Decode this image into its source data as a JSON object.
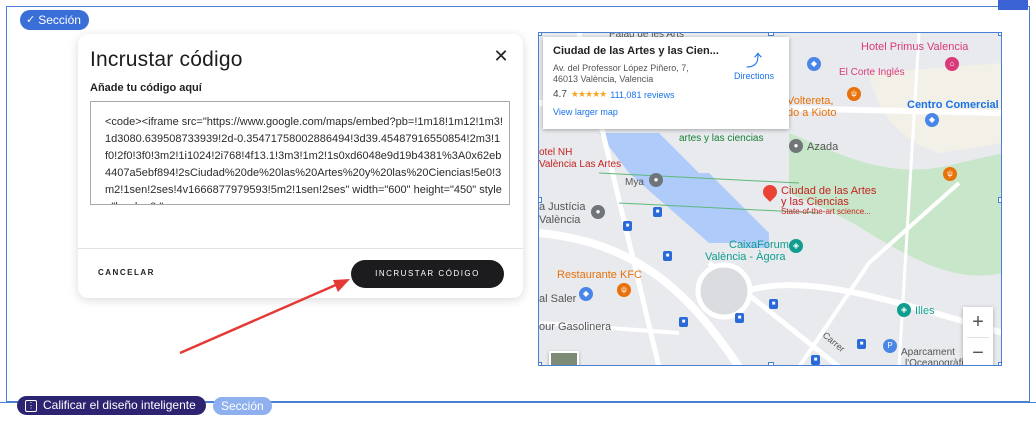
{
  "section_badge": {
    "icon": "check-icon",
    "label": "Sección"
  },
  "modal": {
    "title": "Incrustar código",
    "close_icon": "close-icon",
    "label": "Añade tu código aquí",
    "code": "<code><iframe src=\"https://www.google.com/maps/embed?pb=!1m18!1m12!1m3!1d3080.639508733939!2d-0.35471758002886494!3d39.45487916550854!2m3!1f0!2f0!3f0!3m2!1i1024!2i768!4f13.1!3m3!1m2!1s0xd6048e9d19b4381%3A0x62eb4407a5ebf894!2sCiudad%20de%20las%20Artes%20y%20las%20Ciencias!5e0!3m2!1sen!2ses!4v1666877979593!5m2!1sen!2ses\" width=\"600\" height=\"450\" style=\"border:0;\"",
    "cancel_label": "CANCELAR",
    "submit_label": "INCRUSTAR CÓDIGO"
  },
  "map": {
    "place_name": "Ciudad de las Artes y las Cien...",
    "address_line1": "Av. del Professor López Piñero, 7,",
    "address_line2": "46013 València, Valencia",
    "rating": "4.7",
    "stars": "★★★★★",
    "reviews": "111,081 reviews",
    "larger_map": "View larger map",
    "directions": "Directions",
    "labels": {
      "palau": "Palau de les Arts",
      "hotel_primus": "Hotel Primus Valencia",
      "el_corte": "El Corte Inglés",
      "centro_comercial": "Centro Comercial",
      "voltereta": "Voltereta,",
      "do_a_kioto": "do a Kioto",
      "artes_ciencias": "artes y las ciencias",
      "azada": "Azada",
      "tel_nh": "otel NH",
      "valencia_artes": "València Las Artes",
      "mya": "Mya",
      "ciudad_line1": "Ciudad de las Artes",
      "ciudad_line2": "y las Ciencias",
      "ciudad_sub": "State-of-the-art science...",
      "justicia": "a Justícia",
      "valencia_j": "València",
      "caixaforum": "CaixaForum",
      "caixaforum2": "València - Àgora",
      "kfc": "Restaurante KFC",
      "saler": "al Saler",
      "gasolinera": "our Gasolinera",
      "illes": "Illes",
      "aparcament": "Aparcament",
      "oceanografic": "l'Oceanogràfic",
      "carrer": "Carrer"
    },
    "zoom_in": "+",
    "zoom_out": "−"
  },
  "bottom": {
    "rate_label": "Calificar el diseño inteligente",
    "rate_icon": "rate-layout-icon",
    "section_label": "Sección"
  }
}
